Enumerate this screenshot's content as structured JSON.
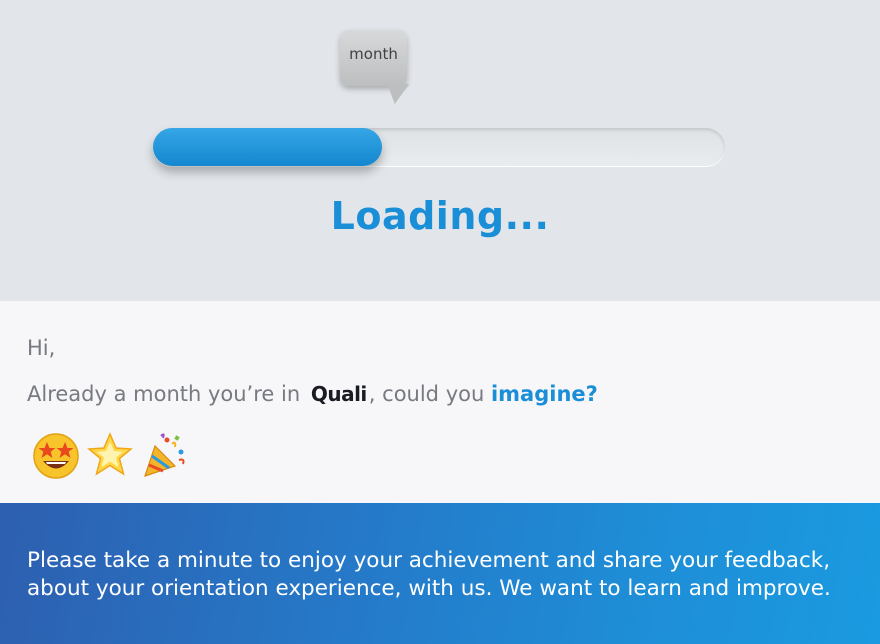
{
  "hero": {
    "tooltip": "month",
    "progress": 0.4,
    "loading_text": "Loading..."
  },
  "greeting": "Hi,",
  "message": {
    "before": "Already a month you’re in",
    "brand": "Quali",
    "after": ", could you",
    "accent": "imagine?"
  },
  "emojis": [
    "star-struck-face-icon",
    "glowing-star-icon",
    "party-popper-icon"
  ],
  "banner": {
    "text": "Please take a minute to enjoy your achievement and share your feedback, about your orientation experience, with us. We want to learn and improve."
  },
  "colors": {
    "accent": "#1a8ed6",
    "banner_start": "#2e5fb0",
    "banner_end": "#1a9ae0"
  }
}
